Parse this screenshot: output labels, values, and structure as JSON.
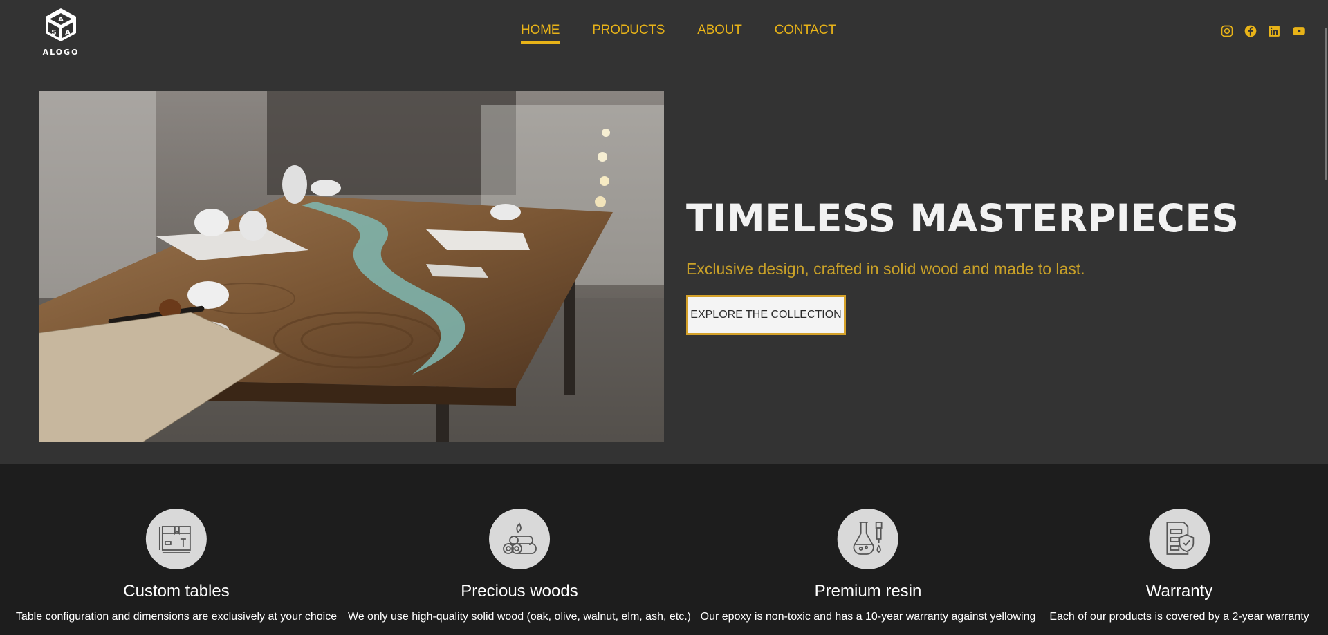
{
  "brand": {
    "logo_text": "ALOGO"
  },
  "nav": {
    "items": [
      {
        "label": "HOME",
        "active": true
      },
      {
        "label": "PRODUCTS",
        "active": false
      },
      {
        "label": "ABOUT",
        "active": false
      },
      {
        "label": "CONTACT",
        "active": false
      }
    ]
  },
  "social": {
    "icons": [
      "instagram-icon",
      "facebook-icon",
      "linkedin-icon",
      "youtube-icon"
    ]
  },
  "hero": {
    "title": "TIMELESS MASTERPIECES",
    "subtitle": "Exclusive design, crafted in solid wood and made to last.",
    "cta_label": "EXPLORE THE COLLECTION"
  },
  "features": [
    {
      "icon": "custom-table-icon",
      "title": "Custom tables",
      "desc": "Table configuration and dimensions are exclusively at your choice"
    },
    {
      "icon": "wood-logs-icon",
      "title": "Precious woods",
      "desc": "We only use high-quality solid wood (oak, olive, walnut, elm, ash, etc.)"
    },
    {
      "icon": "resin-flask-icon",
      "title": "Premium resin",
      "desc": "Our epoxy is non-toxic and has a 10-year warranty against yellowing"
    },
    {
      "icon": "warranty-shield-icon",
      "title": "Warranty",
      "desc": "Each of our products is covered by a 2-year warranty"
    }
  ],
  "colors": {
    "accent": "#e8b318",
    "header_bg": "#333333",
    "features_bg": "#1d1d1d",
    "button_border": "#d4a12a"
  }
}
